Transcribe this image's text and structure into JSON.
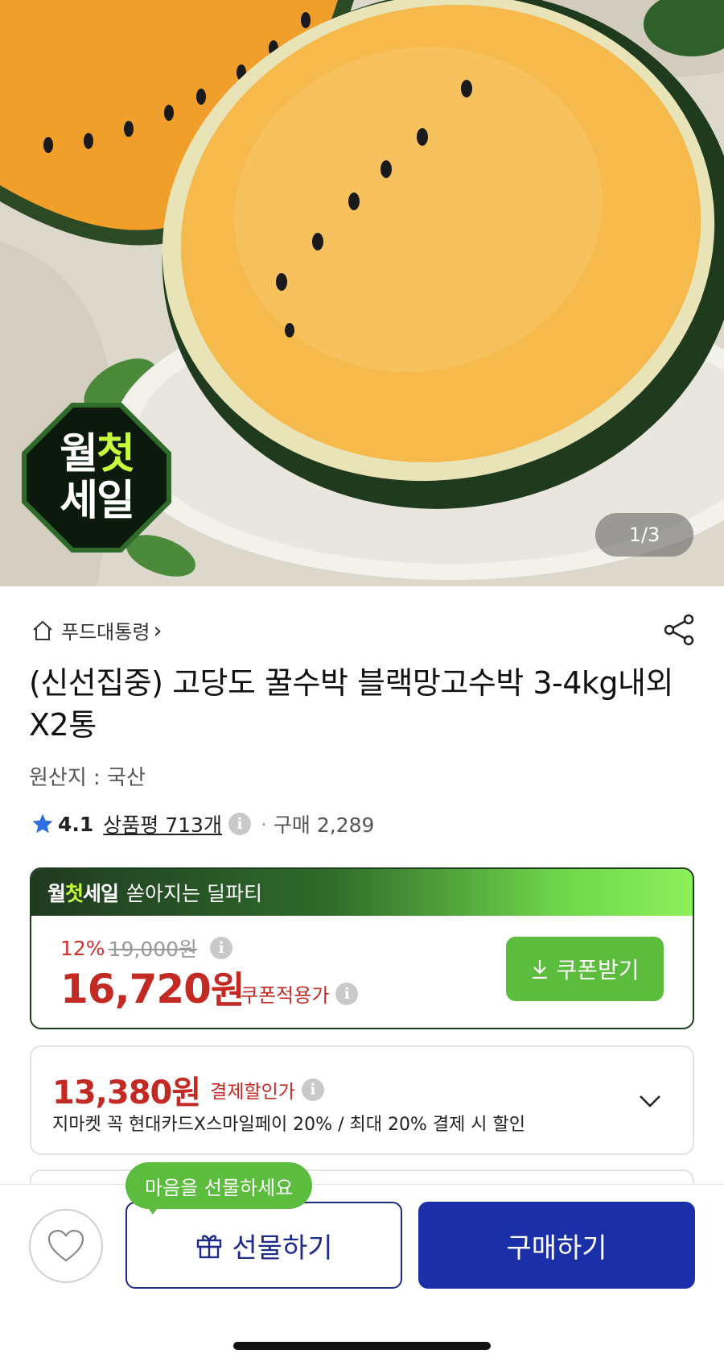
{
  "hero": {
    "image_counter": "1/3",
    "badge": {
      "line1_a": "월",
      "line1_b": "첫",
      "line2": "세일"
    }
  },
  "breadcrumb": {
    "label": "푸드대통령",
    "chevron": "›"
  },
  "product": {
    "title": "(신선집중) 고당도 꿀수박 블랙망고수박 3-4kg내외X2통",
    "origin": "원산지 : 국산"
  },
  "rating": {
    "score": "4.1",
    "reviews": "상품평 713개",
    "separator": "·",
    "purchases": "구매 2,289"
  },
  "sale": {
    "brand_a": "월",
    "brand_b": "첫",
    "brand_c": "세일",
    "headline": "쏟아지는 딜파티",
    "discount_pct": "12%",
    "original_price": "19,000원",
    "price_number": "16,720",
    "price_unit": "원",
    "price_note": "쿠폰적용가",
    "coupon_button": "쿠폰받기"
  },
  "payment": {
    "price": "13,380원",
    "label": "결제할인가",
    "description": "지마켓 꼭 현대카드X스마일페이 20% / 최대 20% 결제 시 할인"
  },
  "bottom_bar": {
    "tooltip": "마음을 선물하세요",
    "gift_button": "선물하기",
    "buy_button": "구매하기"
  },
  "colors": {
    "price_red": "#c42a24",
    "sale_green": "#5cbc3d",
    "buy_blue": "#1a2fa8",
    "gift_border": "#1e2a8a"
  },
  "icons": [
    "home-icon",
    "share-icon",
    "star-icon",
    "info-icon",
    "download-icon",
    "chevron-down-icon",
    "heart-icon",
    "gift-icon"
  ]
}
